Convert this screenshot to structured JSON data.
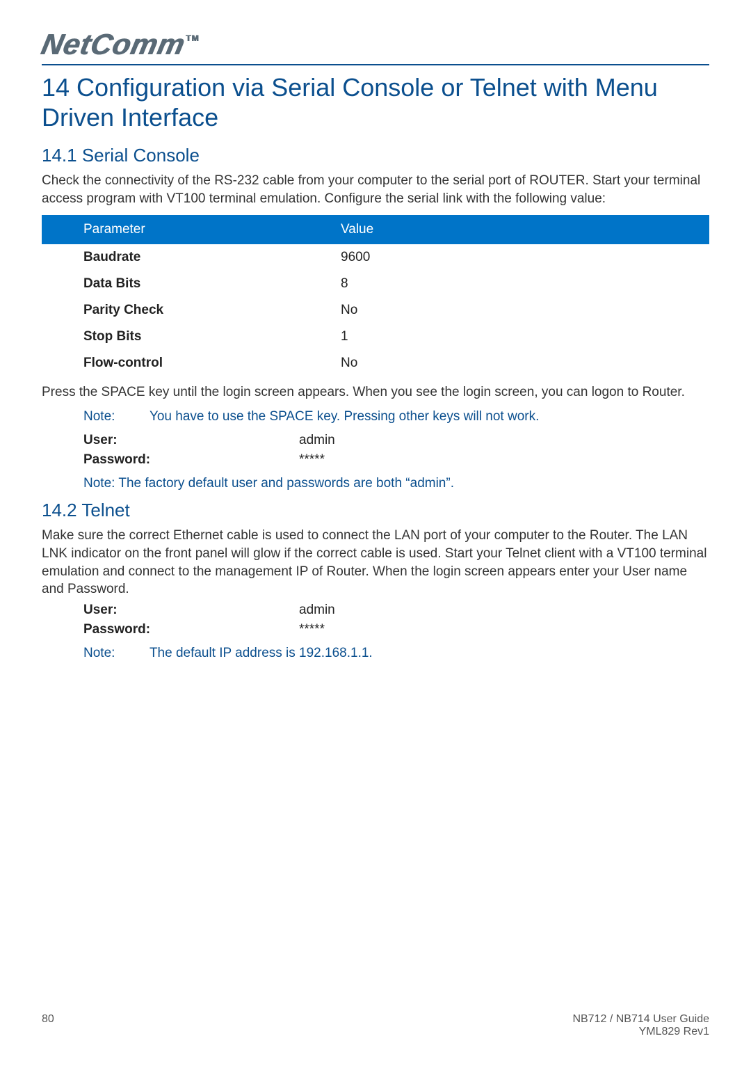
{
  "brand": "NetComm",
  "brand_tm": "TM",
  "chapter_title": "14 Configuration via Serial Console or Telnet with Menu Driven Interface",
  "section1": {
    "heading": "14.1 Serial Console",
    "para1": "Check the connectivity of the RS-232 cable from your computer to the serial port of ROUTER. Start your terminal access program with VT100 terminal emulation. Configure the serial link with the following value:",
    "table": {
      "header": [
        "Parameter",
        "Value"
      ],
      "rows": [
        [
          "Baudrate",
          "9600"
        ],
        [
          "Data Bits",
          "8"
        ],
        [
          "Parity Check",
          "No"
        ],
        [
          "Stop Bits",
          "1"
        ],
        [
          "Flow-control",
          "No"
        ]
      ]
    },
    "para2": "Press the SPACE key until the login screen appears. When you see the login screen, you can logon to Router.",
    "note1_label": "Note:",
    "note1_text": "You have to use the SPACE key. Pressing other keys will not work.",
    "creds": [
      [
        "User:",
        "admin"
      ],
      [
        "Password:",
        "*****"
      ]
    ],
    "note2": "Note: The factory default user and passwords are both “admin”."
  },
  "section2": {
    "heading": "14.2 Telnet",
    "para1": "Make sure the correct Ethernet cable is used to connect the LAN port of your computer to the Router. The LAN LNK indicator on the front panel will glow if the correct cable is used. Start your Telnet client with a VT100 terminal emulation and connect to the management IP of Router.  When the login screen appears enter your User name and Password.",
    "creds": [
      [
        "User:",
        "admin"
      ],
      [
        "Password:",
        "*****"
      ]
    ],
    "note_label": "Note:",
    "note_text": "The default IP address is 192.168.1.1."
  },
  "footer": {
    "page": "80",
    "guide": "NB712 / NB714 User Guide",
    "rev": "YML829 Rev1"
  }
}
